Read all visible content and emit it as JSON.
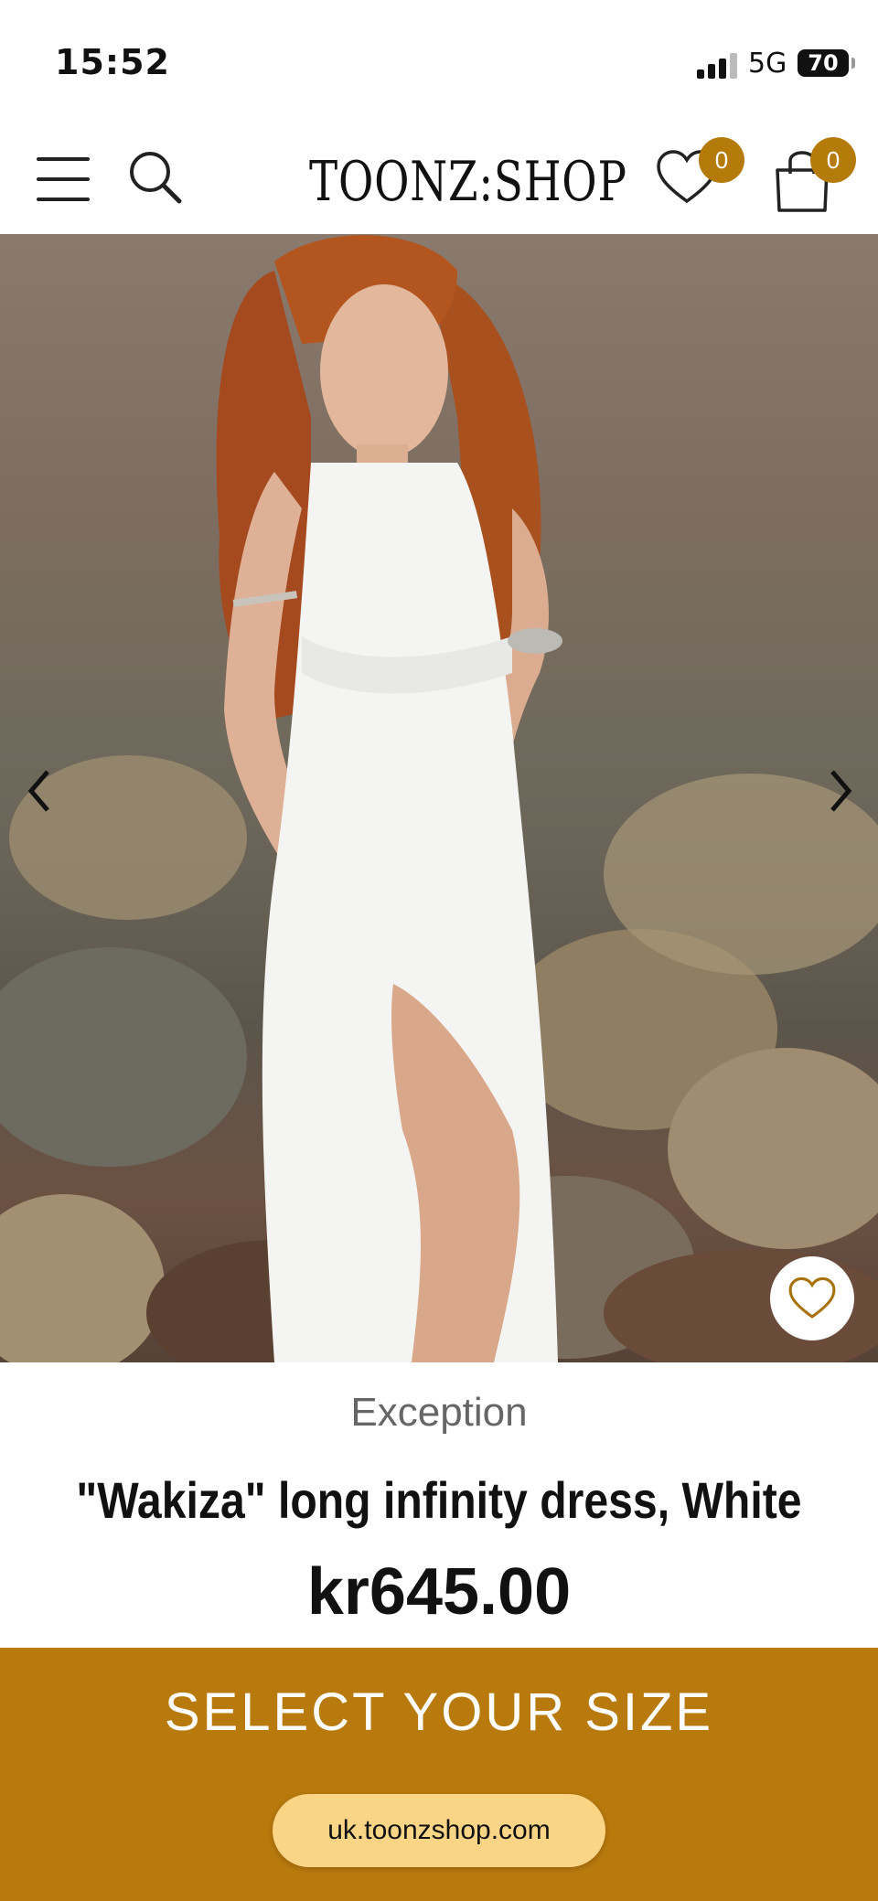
{
  "status_bar": {
    "time": "15:52",
    "network": "5G",
    "battery": "70"
  },
  "header": {
    "logo_text": "TOONZ:SHOP",
    "wishlist_count": "0",
    "cart_count": "0"
  },
  "product": {
    "brand": "Exception",
    "title": "\"Wakiza\" long infinity dress, White",
    "price": "kr645.00"
  },
  "actions": {
    "select_size_label": "SELECT YOUR SIZE"
  },
  "browser": {
    "url": "uk.toonzshop.com"
  },
  "colors": {
    "accent": "#b8790d",
    "badge": "#b47b0a",
    "url_pill": "#fbd586"
  }
}
